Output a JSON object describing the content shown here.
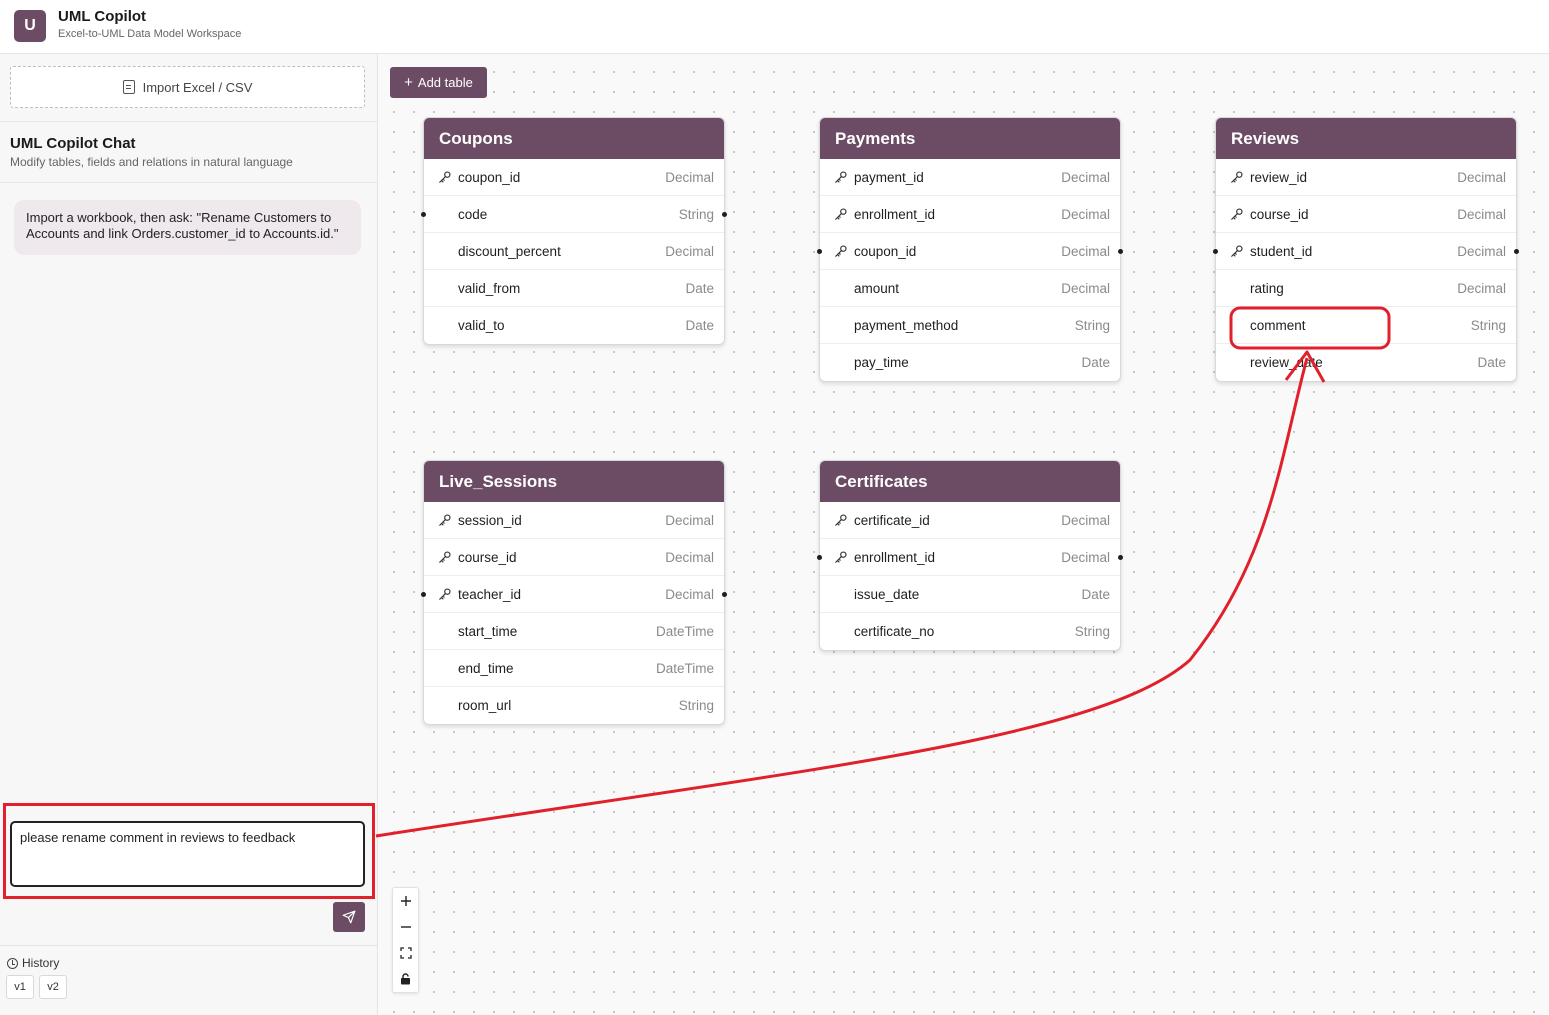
{
  "app": {
    "logo_letter": "U",
    "title": "UML Copilot",
    "subtitle": "Excel-to-UML Data Model Workspace"
  },
  "sidebar": {
    "import_label": "Import Excel / CSV",
    "chat_title": "UML Copilot Chat",
    "chat_subtitle": "Modify tables, fields and relations in natural language",
    "hint": "Import a workbook, then ask: \"Rename Customers to Accounts and link Orders.customer_id to Accounts.id.\"",
    "input_value": "please rename comment in reviews to feedback",
    "history_label": "History",
    "versions": [
      "v1",
      "v2"
    ]
  },
  "canvas": {
    "add_table_label": "Add table",
    "zoom_controls": [
      "zoom-in",
      "zoom-out",
      "fit-view",
      "lock"
    ]
  },
  "tables": {
    "coupons": {
      "name": "Coupons",
      "fields": [
        {
          "name": "coupon_id",
          "type": "Decimal",
          "key": true
        },
        {
          "name": "code",
          "type": "String",
          "key": false
        },
        {
          "name": "discount_percent",
          "type": "Decimal",
          "key": false
        },
        {
          "name": "valid_from",
          "type": "Date",
          "key": false
        },
        {
          "name": "valid_to",
          "type": "Date",
          "key": false
        }
      ]
    },
    "payments": {
      "name": "Payments",
      "fields": [
        {
          "name": "payment_id",
          "type": "Decimal",
          "key": true
        },
        {
          "name": "enrollment_id",
          "type": "Decimal",
          "key": true
        },
        {
          "name": "coupon_id",
          "type": "Decimal",
          "key": true
        },
        {
          "name": "amount",
          "type": "Decimal",
          "key": false
        },
        {
          "name": "payment_method",
          "type": "String",
          "key": false
        },
        {
          "name": "pay_time",
          "type": "Date",
          "key": false
        }
      ]
    },
    "reviews": {
      "name": "Reviews",
      "fields": [
        {
          "name": "review_id",
          "type": "Decimal",
          "key": true
        },
        {
          "name": "course_id",
          "type": "Decimal",
          "key": true
        },
        {
          "name": "student_id",
          "type": "Decimal",
          "key": true
        },
        {
          "name": "rating",
          "type": "Decimal",
          "key": false
        },
        {
          "name": "comment",
          "type": "String",
          "key": false
        },
        {
          "name": "review_date",
          "type": "Date",
          "key": false
        }
      ]
    },
    "live_sessions": {
      "name": "Live_Sessions",
      "fields": [
        {
          "name": "session_id",
          "type": "Decimal",
          "key": true
        },
        {
          "name": "course_id",
          "type": "Decimal",
          "key": true
        },
        {
          "name": "teacher_id",
          "type": "Decimal",
          "key": true
        },
        {
          "name": "start_time",
          "type": "DateTime",
          "key": false
        },
        {
          "name": "end_time",
          "type": "DateTime",
          "key": false
        },
        {
          "name": "room_url",
          "type": "String",
          "key": false
        }
      ]
    },
    "certificates": {
      "name": "Certificates",
      "fields": [
        {
          "name": "certificate_id",
          "type": "Decimal",
          "key": true
        },
        {
          "name": "enrollment_id",
          "type": "Decimal",
          "key": true
        },
        {
          "name": "issue_date",
          "type": "Date",
          "key": false
        },
        {
          "name": "certificate_no",
          "type": "String",
          "key": false
        }
      ]
    }
  },
  "colors": {
    "accent": "#6b4c64",
    "annotation": "#e0202a"
  }
}
